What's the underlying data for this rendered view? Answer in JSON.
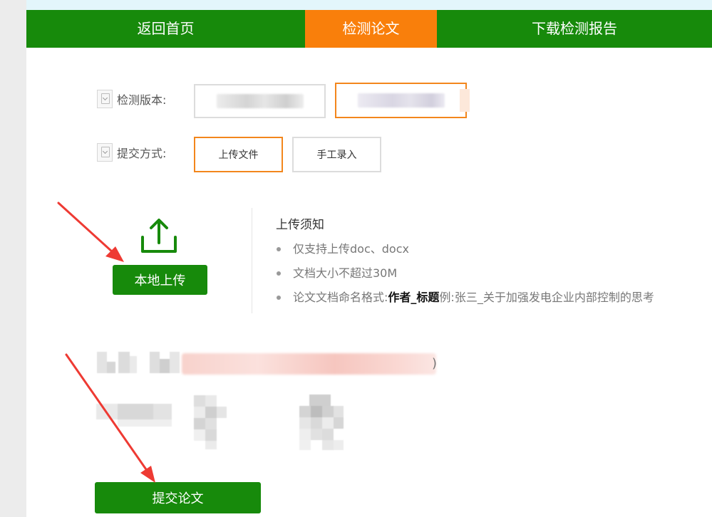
{
  "nav": {
    "tabs": [
      {
        "label": "返回首页"
      },
      {
        "label": "检测论文"
      },
      {
        "label": "下载检测报告"
      }
    ],
    "active_index": 1,
    "colors": {
      "bar": "#178a0b",
      "active": "#f97f0b"
    }
  },
  "form": {
    "version_label": "检测版本:",
    "method_label": "提交方式:",
    "methods": [
      {
        "label": "上传文件"
      },
      {
        "label": "手工录入"
      }
    ]
  },
  "upload": {
    "icon": "upload-icon",
    "button_label": "本地上传"
  },
  "notice": {
    "title": "上传须知",
    "items": [
      {
        "text": "仅支持上传doc、docx"
      },
      {
        "text": "文档大小不超过30M"
      },
      {
        "text_prefix": "论文文档命名格式:",
        "bold": "作者_标题",
        "text_suffix": " 例:张三_关于加强发电企业内部控制的思考"
      }
    ]
  },
  "blurred_paren": ")",
  "submit_label": "提交论文",
  "accent_colors": {
    "green": "#178a0b",
    "orange": "#f3861c"
  }
}
